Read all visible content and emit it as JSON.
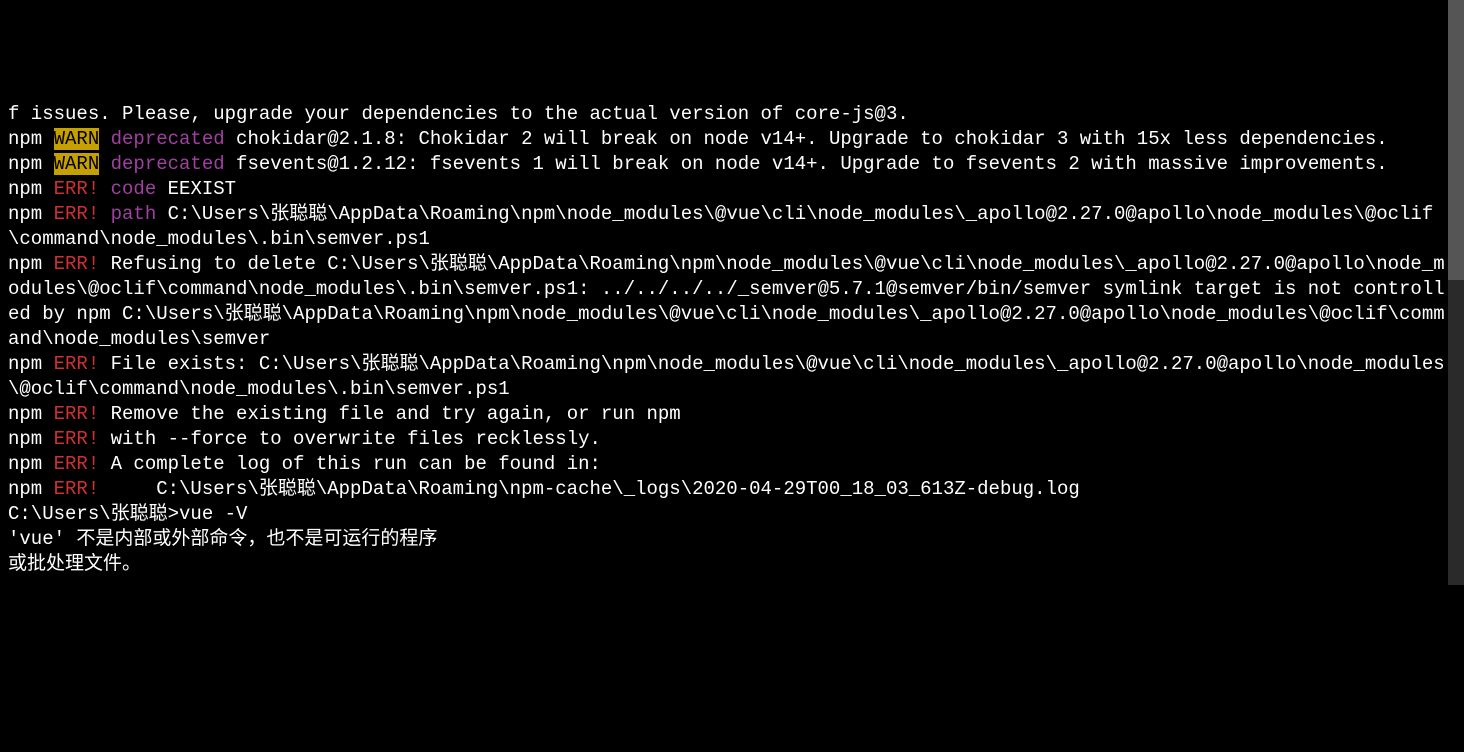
{
  "lines": {
    "l0": "f issues. Please, upgrade your dependencies to the actual version of core-js@3.",
    "l1_npm": "npm ",
    "l1_warn": "WARN",
    "l1_depr": " deprecated",
    "l1_rest": " chokidar@2.1.8: Chokidar 2 will break on node v14+. Upgrade to chokidar 3 with 15x less dependencies.",
    "l2_npm": "npm ",
    "l2_warn": "WARN",
    "l2_depr": " deprecated",
    "l2_rest": " fsevents@1.2.12: fsevents 1 will break on node v14+. Upgrade to fsevents 2 with massive improvements.",
    "l3_npm": "npm ",
    "l3_err": "ERR!",
    "l3_key": " code",
    "l3_rest": " EEXIST",
    "l4_npm": "npm ",
    "l4_err": "ERR!",
    "l4_key": " path",
    "l4_rest": " C:\\Users\\张聪聪\\AppData\\Roaming\\npm\\node_modules\\@vue\\cli\\node_modules\\_apollo@2.27.0@apollo\\node_modules\\@oclif\\command\\node_modules\\.bin\\semver.ps1",
    "l5_npm": "npm ",
    "l5_err": "ERR!",
    "l5_rest": " Refusing to delete C:\\Users\\张聪聪\\AppData\\Roaming\\npm\\node_modules\\@vue\\cli\\node_modules\\_apollo@2.27.0@apollo\\node_modules\\@oclif\\command\\node_modules\\.bin\\semver.ps1: ../../../../_semver@5.7.1@semver/bin/semver symlink target is not controlled by npm C:\\Users\\张聪聪\\AppData\\Roaming\\npm\\node_modules\\@vue\\cli\\node_modules\\_apollo@2.27.0@apollo\\node_modules\\@oclif\\command\\node_modules\\semver",
    "l6_npm": "npm ",
    "l6_err": "ERR!",
    "l6_rest": " File exists: C:\\Users\\张聪聪\\AppData\\Roaming\\npm\\node_modules\\@vue\\cli\\node_modules\\_apollo@2.27.0@apollo\\node_modules\\@oclif\\command\\node_modules\\.bin\\semver.ps1",
    "l7_npm": "npm ",
    "l7_err": "ERR!",
    "l7_rest": " Remove the existing file and try again, or run npm",
    "l8_npm": "npm ",
    "l8_err": "ERR!",
    "l8_rest": " with --force to overwrite files recklessly.",
    "blank": "",
    "l9_npm": "npm ",
    "l9_err": "ERR!",
    "l9_rest": " A complete log of this run can be found in:",
    "l10_npm": "npm ",
    "l10_err": "ERR!",
    "l10_rest": "     C:\\Users\\张聪聪\\AppData\\Roaming\\npm-cache\\_logs\\2020-04-29T00_18_03_613Z-debug.log",
    "prompt1": "C:\\Users\\张聪聪>vue -V",
    "msg1": "'vue' 不是内部或外部命令，也不是可运行的程序",
    "msg2": "或批处理文件。"
  }
}
